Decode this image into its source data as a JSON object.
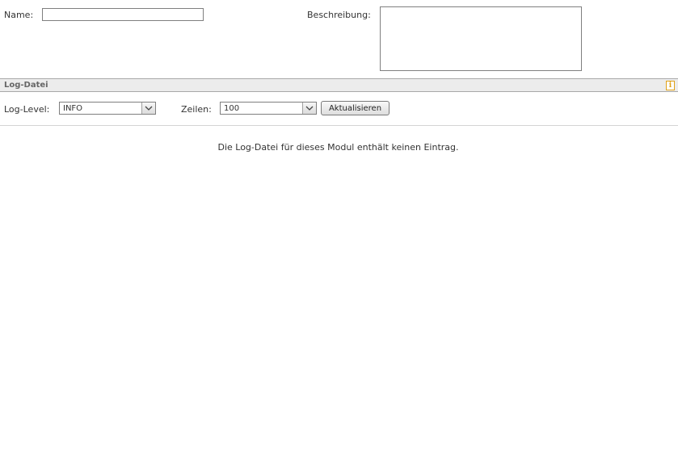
{
  "form": {
    "name_label": "Name:",
    "name_value": "",
    "description_label": "Beschreibung:",
    "description_value": ""
  },
  "log_section": {
    "title": "Log-Datei",
    "info_icon": "info-icon",
    "log_level_label": "Log-Level:",
    "log_level_value": "INFO",
    "lines_label": "Zeilen:",
    "lines_value": "100",
    "refresh_label": "Aktualisieren",
    "empty_message": "Die Log-Datei für dieses Modul enthält keinen Eintrag."
  },
  "colors": {
    "header_background": "#ececec",
    "info_accent": "#e0a21a"
  }
}
